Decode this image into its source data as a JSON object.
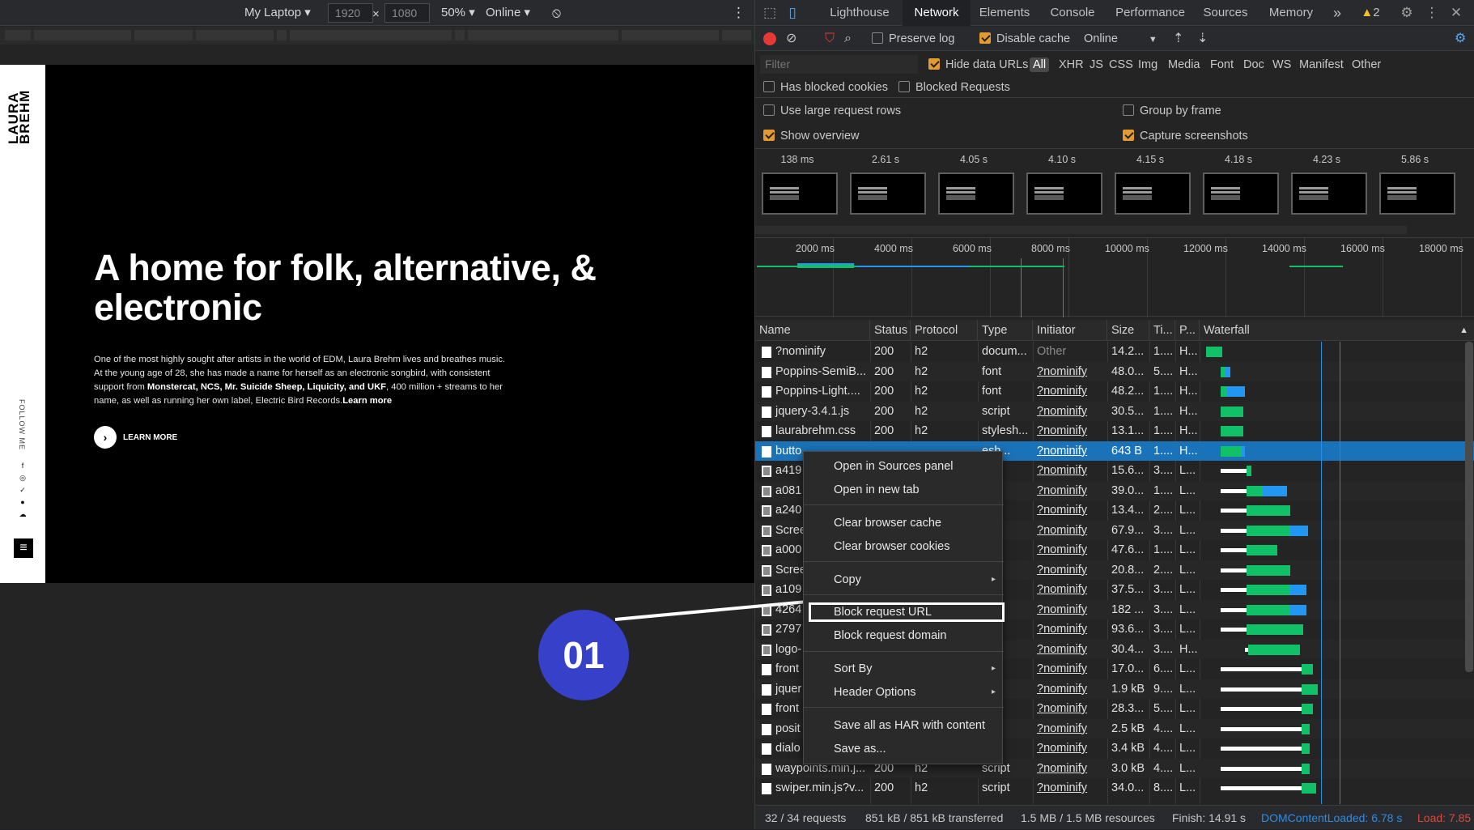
{
  "emulation": {
    "device": "My Laptop",
    "width": "1920",
    "height": "1080",
    "times": "×",
    "zoom": "50%",
    "network": "Online"
  },
  "site": {
    "brand": "LAURA\nBREHM",
    "follow_label": "FOLLOW ME",
    "hero_title": "A home for folk, alternative, & electronic",
    "hero_text_1": "One of the most highly sought after artists in the world of EDM, Laura Brehm lives and breathes music. At the young age of 28, she has made a name for herself as an electronic songbird, with consistent support from ",
    "hero_text_bold": "Monstercat, NCS, Mr. Suicide Sheep, Liquicity, and UKF",
    "hero_text_2": ", 400 million + streams to her name, as well as running her own label, Electric Bird Records.",
    "hero_text_more": "Learn more",
    "learn_more": "LEARN MORE"
  },
  "callout": {
    "number": "01"
  },
  "devtools": {
    "tabs": [
      "Lighthouse",
      "Network",
      "Elements",
      "Console",
      "Performance",
      "Sources",
      "Memory"
    ],
    "active_tab": "Network",
    "more_tabs": "»",
    "warnings": "2",
    "toolbar": {
      "preserve_log": "Preserve log",
      "disable_cache": "Disable cache",
      "throttle": "Online"
    },
    "filter": {
      "placeholder": "Filter",
      "hide_data_urls": "Hide data URLs",
      "types": [
        "All",
        "XHR",
        "JS",
        "CSS",
        "Img",
        "Media",
        "Font",
        "Doc",
        "WS",
        "Manifest",
        "Other"
      ],
      "has_blocked_cookies": "Has blocked cookies",
      "blocked_requests": "Blocked Requests"
    },
    "options": {
      "large_rows": "Use large request rows",
      "group_by_frame": "Group by frame",
      "show_overview": "Show overview",
      "capture_screenshots": "Capture screenshots"
    },
    "filmstrip": [
      "138 ms",
      "2.61 s",
      "4.05 s",
      "4.10 s",
      "4.15 s",
      "4.18 s",
      "4.23 s",
      "5.86 s"
    ],
    "overview_ticks": [
      "2000 ms",
      "4000 ms",
      "6000 ms",
      "8000 ms",
      "10000 ms",
      "12000 ms",
      "14000 ms",
      "16000 ms",
      "18000 ms"
    ],
    "columns": [
      "Name",
      "Status",
      "Protocol",
      "Type",
      "Initiator",
      "Size",
      "Ti...",
      "P...",
      "Waterfall"
    ],
    "rows": [
      {
        "name": "?nominify",
        "status": "200",
        "protocol": "h2",
        "type": "docum...",
        "initiator": "Other",
        "size": "14.2...",
        "time": "1....",
        "priority": "H...",
        "icon": "doc"
      },
      {
        "name": "Poppins-SemiB...",
        "status": "200",
        "protocol": "h2",
        "type": "font",
        "initiator": "?nominify",
        "size": "48.0...",
        "time": "5....",
        "priority": "H...",
        "icon": "doc"
      },
      {
        "name": "Poppins-Light....",
        "status": "200",
        "protocol": "h2",
        "type": "font",
        "initiator": "?nominify",
        "size": "48.2...",
        "time": "1....",
        "priority": "H...",
        "icon": "doc"
      },
      {
        "name": "jquery-3.4.1.js",
        "status": "200",
        "protocol": "h2",
        "type": "script",
        "initiator": "?nominify",
        "size": "30.5...",
        "time": "1....",
        "priority": "H...",
        "icon": "doc"
      },
      {
        "name": "laurabrehm.css",
        "status": "200",
        "protocol": "h2",
        "type": "stylesh...",
        "initiator": "?nominify",
        "size": "13.1...",
        "time": "1....",
        "priority": "H...",
        "icon": "doc"
      },
      {
        "name": "butto",
        "status": "",
        "protocol": "",
        "type": "esh...",
        "initiator": "?nominify",
        "size": "643 B",
        "time": "1....",
        "priority": "H...",
        "icon": "doc"
      },
      {
        "name": "a419",
        "status": "",
        "protocol": "",
        "type": "",
        "initiator": "?nominify",
        "size": "15.6...",
        "time": "3....",
        "priority": "L...",
        "icon": "img"
      },
      {
        "name": "a081",
        "status": "",
        "protocol": "",
        "type": "",
        "initiator": "?nominify",
        "size": "39.0...",
        "time": "1....",
        "priority": "L...",
        "icon": "img"
      },
      {
        "name": "a240",
        "status": "",
        "protocol": "",
        "type": "",
        "initiator": "?nominify",
        "size": "13.4...",
        "time": "2....",
        "priority": "L...",
        "icon": "img"
      },
      {
        "name": "Scree",
        "status": "",
        "protocol": "",
        "type": "",
        "initiator": "?nominify",
        "size": "67.9...",
        "time": "3....",
        "priority": "L...",
        "icon": "img"
      },
      {
        "name": "a000",
        "status": "",
        "protocol": "",
        "type": "",
        "initiator": "?nominify",
        "size": "47.6...",
        "time": "1....",
        "priority": "L...",
        "icon": "img"
      },
      {
        "name": "Scree",
        "status": "",
        "protocol": "",
        "type": "",
        "initiator": "?nominify",
        "size": "20.8...",
        "time": "2....",
        "priority": "L...",
        "icon": "img"
      },
      {
        "name": "a109",
        "status": "",
        "protocol": "",
        "type": "",
        "initiator": "?nominify",
        "size": "37.5...",
        "time": "3....",
        "priority": "L...",
        "icon": "img"
      },
      {
        "name": "4264",
        "status": "",
        "protocol": "",
        "type": "",
        "initiator": "?nominify",
        "size": "182 ...",
        "time": "3....",
        "priority": "L...",
        "icon": "img"
      },
      {
        "name": "2797",
        "status": "",
        "protocol": "",
        "type": "",
        "initiator": "?nominify",
        "size": "93.6...",
        "time": "3....",
        "priority": "L...",
        "icon": "img"
      },
      {
        "name": "logo-",
        "status": "",
        "protocol": "",
        "type": "",
        "initiator": "?nominify",
        "size": "30.4...",
        "time": "3....",
        "priority": "H...",
        "icon": "img"
      },
      {
        "name": "front",
        "status": "",
        "protocol": "",
        "type": "pt",
        "initiator": "?nominify",
        "size": "17.0...",
        "time": "6....",
        "priority": "L...",
        "icon": "doc"
      },
      {
        "name": "jquer",
        "status": "",
        "protocol": "",
        "type": "pt",
        "initiator": "?nominify",
        "size": "1.9 kB",
        "time": "9....",
        "priority": "L...",
        "icon": "doc"
      },
      {
        "name": "front",
        "status": "",
        "protocol": "",
        "type": "pt",
        "initiator": "?nominify",
        "size": "28.3...",
        "time": "5....",
        "priority": "L...",
        "icon": "doc"
      },
      {
        "name": "posit",
        "status": "",
        "protocol": "",
        "type": "pt",
        "initiator": "?nominify",
        "size": "2.5 kB",
        "time": "4....",
        "priority": "L...",
        "icon": "doc"
      },
      {
        "name": "dialo",
        "status": "",
        "protocol": "",
        "type": "pt",
        "initiator": "?nominify",
        "size": "3.4 kB",
        "time": "4....",
        "priority": "L...",
        "icon": "doc"
      },
      {
        "name": "waypoints.min.j...",
        "status": "200",
        "protocol": "h2",
        "type": "script",
        "initiator": "?nominify",
        "size": "3.0 kB",
        "time": "4....",
        "priority": "L...",
        "icon": "doc"
      },
      {
        "name": "swiper.min.js?v...",
        "status": "200",
        "protocol": "h2",
        "type": "script",
        "initiator": "?nominify",
        "size": "34.0...",
        "time": "8....",
        "priority": "L...",
        "icon": "doc"
      }
    ],
    "selected_row": 5,
    "status": {
      "requests": "32 / 34 requests",
      "transferred": "851 kB / 851 kB transferred",
      "resources": "1.5 MB / 1.5 MB resources",
      "finish": "Finish: 14.91 s",
      "dcl": "DOMContentLoaded: 6.78 s",
      "load": "Load: 7.85"
    },
    "colors": {
      "dcl": "#2d8ce3",
      "load": "#e2463a",
      "green": "#11c167",
      "blue": "#2196f3",
      "selection": "#1a73b8"
    }
  },
  "context_menu": {
    "items": [
      "Open in Sources panel",
      "Open in new tab",
      "Clear browser cache",
      "Clear browser cookies",
      "Copy",
      "Block request URL",
      "Block request domain",
      "Sort By",
      "Header Options",
      "Save all as HAR with content",
      "Save as..."
    ],
    "highlighted": "Block request URL",
    "submenu_arrow": "▸"
  }
}
